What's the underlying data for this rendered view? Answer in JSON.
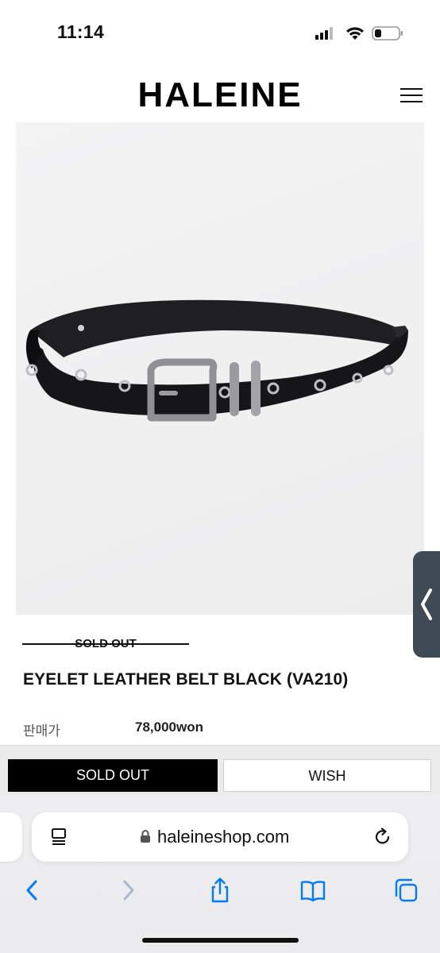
{
  "status_bar": {
    "time": "11:14",
    "icons": [
      "signal-icon",
      "wifi-icon",
      "battery-icon"
    ]
  },
  "header": {
    "brand": "HALEINE",
    "menu_icon": "hamburger-menu-icon"
  },
  "product": {
    "image_alt_icon": "belt-image",
    "sold_out_tag": "SOLD OUT",
    "name": "EYELET LEATHER BELT BLACK (VA210)",
    "price_label": "판매가",
    "price_value": "78,000won"
  },
  "actions": {
    "sold_out_button": "SOLD OUT",
    "wish_button": "WISH"
  },
  "browser": {
    "url": "haleineshop.com",
    "icons": [
      "reader-icon",
      "lock-icon",
      "reload-icon",
      "back-icon",
      "forward-icon",
      "share-icon",
      "bookmarks-icon",
      "tabs-icon",
      "side-tab-chevron-icon"
    ]
  },
  "colors": {
    "accent": "#007aff",
    "brand_black": "#000000",
    "side_tab": "#3f4a55"
  }
}
